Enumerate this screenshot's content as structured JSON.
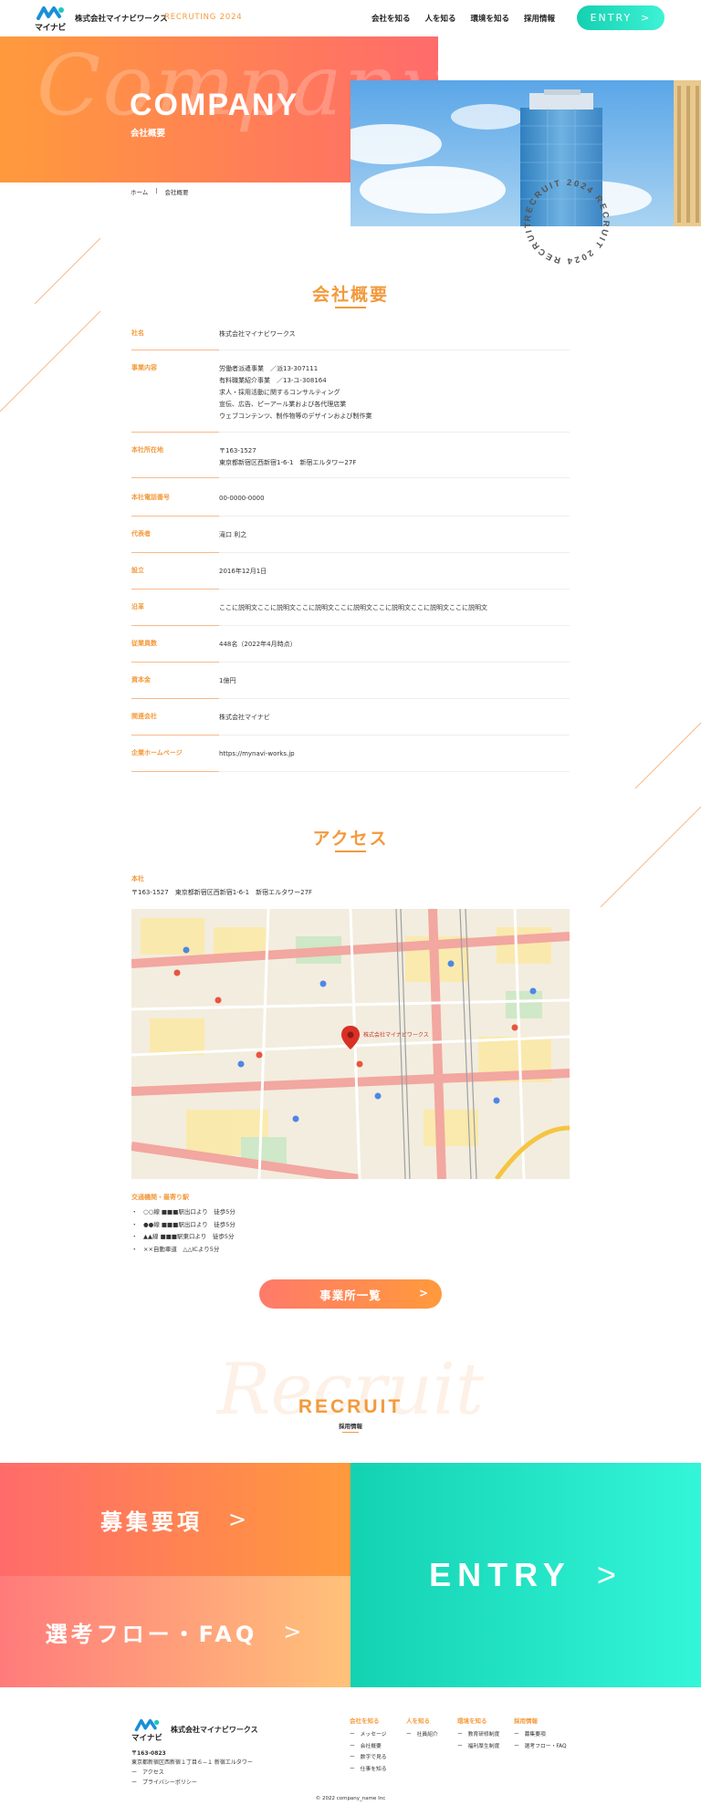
{
  "header": {
    "logo_text": "マイナビ",
    "company": "株式会社マイナビワークス",
    "recruiting": "RECRUTING 2024",
    "nav": [
      "会社を知る",
      "人を知る",
      "環境を知る",
      "採用情報"
    ],
    "entry": "ENTRY"
  },
  "hero": {
    "script": "Company",
    "title": "COMPANY",
    "subtitle": "会社概要",
    "breadcrumb": [
      "ホーム",
      "|",
      "会社概要"
    ],
    "badge_text": "RECRUIT 2024 RECRUIT 2024 RECRUIT 2024 "
  },
  "company": {
    "title": "会社概要",
    "rows": [
      {
        "key": "社名",
        "value": "株式会社マイナビワークス"
      },
      {
        "key": "事業内容",
        "value": "労働者派遣事業　／派13-307111\n有料職業紹介事業　／13-ユ-308164\n求人・採用活動に関するコンサルティング\n宣伝、広告、ピーアール業および各代理店業\nウェブコンテンツ、制作物等のデザインおよび制作業"
      },
      {
        "key": "本社所在地",
        "value": "〒163-1527\n東京都新宿区西新宿1-6-1　新宿エルタワー27F"
      },
      {
        "key": "本社電話番号",
        "value": "00-0000-0000"
      },
      {
        "key": "代表者",
        "value": "滝口 利之"
      },
      {
        "key": "設立",
        "value": "2016年12月1日"
      },
      {
        "key": "沿革",
        "value": "ここに説明文ここに説明文ここに説明文ここに説明文ここに説明文ここに説明文ここに説明文"
      },
      {
        "key": "従業員数",
        "value": "448名（2022年4月時点）"
      },
      {
        "key": "資本金",
        "value": "1億円"
      },
      {
        "key": "関連会社",
        "value": "株式会社マイナビ"
      },
      {
        "key": "企業ホームページ",
        "value": "https://mynavi-works.jp"
      }
    ]
  },
  "access": {
    "title": "アクセス",
    "label": "本社",
    "address": "〒163-1527　東京都新宿区西新宿1-6-1　新宿エルタワー27F",
    "map_pin_label": "株式会社マイナビワークス",
    "transport_title": "交通機関・最寄り駅",
    "transport": [
      "・　○○線 ■■■駅出口より　徒歩5分",
      "・　●●線 ■■■駅出口より　徒歩5分",
      "・　▲▲線 ■■■駅東口より　徒歩5分",
      "・　××自動車道　△△ICより5分"
    ],
    "office_button": "事業所一覧"
  },
  "recruit": {
    "script": "Recruit",
    "title": "RECRUIT",
    "subtitle": "採用情報",
    "boshu": "募集要項",
    "flow": "選考フロー・FAQ",
    "entry": "ENTRY"
  },
  "footer": {
    "logo_text": "マイナビ",
    "company": "株式会社マイナビワークス",
    "zip": "〒163-0823",
    "address": "東京都新宿区西新宿１丁目６−１ 新宿エルタワー",
    "links": [
      "ー　アクセス",
      "ー　プライバシーポリシー"
    ],
    "cols": [
      {
        "head": "会社を知る",
        "items": [
          "ー　メッセージ",
          "ー　会社概要",
          "ー　数字で見る",
          "ー　仕事を知る"
        ]
      },
      {
        "head": "人を知る",
        "items": [
          "ー　社員紹介"
        ]
      },
      {
        "head": "環境を知る",
        "items": [
          "ー　教育研修制度",
          "ー　福利厚生制度"
        ]
      },
      {
        "head": "採用情報",
        "items": [
          "ー　募集要項",
          "ー　選考フロー・FAQ"
        ]
      }
    ],
    "copyright": "© 2022 company_name Inc"
  },
  "colors": {
    "orange": "#f39a3c",
    "coral": "#ff6b6b",
    "teal": "#14d0b0"
  }
}
